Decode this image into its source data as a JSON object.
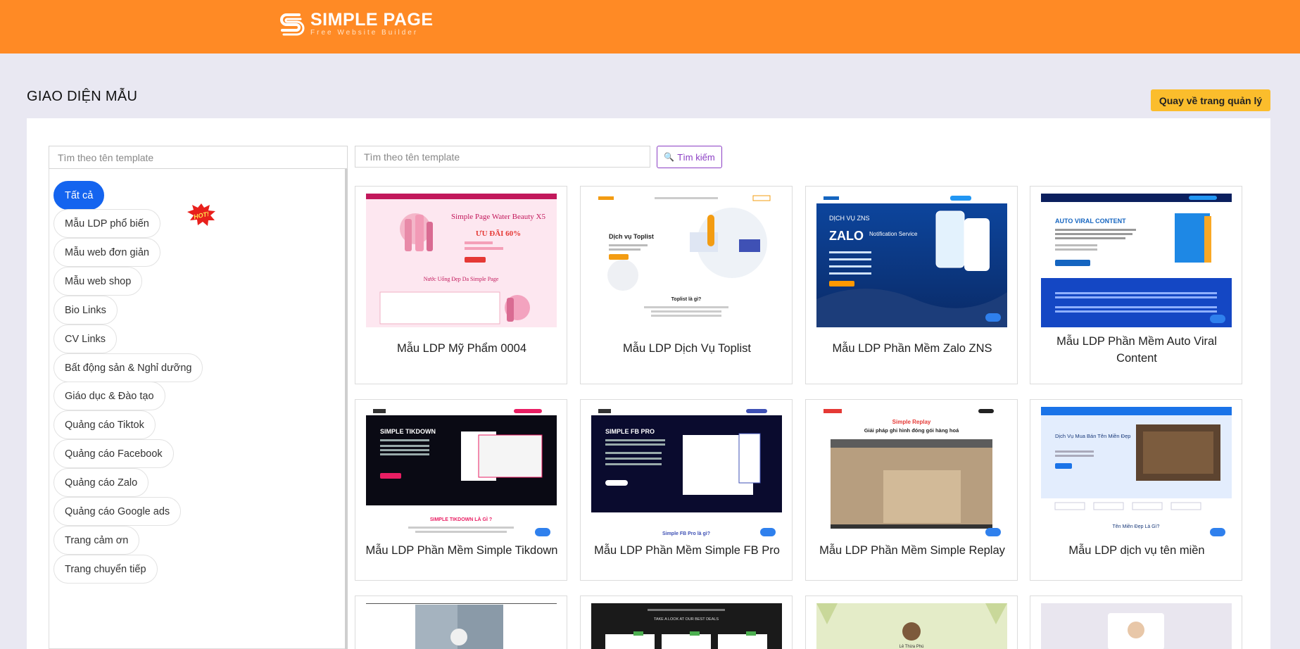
{
  "header": {
    "brand": "SIMPLE PAGE",
    "tagline": "Free Website Builder",
    "bg_color": "#ff8a25"
  },
  "page": {
    "title": "GIAO DIỆN MẪU",
    "back_button": "Quay về trang quản lý"
  },
  "sidebar": {
    "search_placeholder": "Tìm theo tên template",
    "hot_badge": "HOT!",
    "categories": [
      "Tất cả",
      "Mẫu LDP phổ biến",
      "Mẫu web đơn giản",
      "Mẫu web shop",
      "Bio Links",
      "CV Links",
      "Bất động sản & Nghỉ dưỡng",
      "Giáo dục & Đào tạo",
      "Quảng cáo Tiktok",
      "Quảng cáo Facebook",
      "Quảng cáo Zalo",
      "Quảng cáo Google ads",
      "Trang cảm ơn",
      "Trang chuyển tiếp"
    ]
  },
  "main": {
    "search_placeholder": "Tìm theo tên template",
    "search_button": "Tìm kiếm",
    "templates": [
      {
        "name": "Mẫu LDP Mỹ Phẩm 0004",
        "thumb_text": "Simple Page Water Beauty X5",
        "thumb_sub": "ƯU ĐÃI 60%",
        "thumb_line": "Nước Uống Đẹp Da Simple Page"
      },
      {
        "name": "Mẫu LDP Dịch Vụ Toplist",
        "thumb_text": "Dịch vụ Toplist",
        "thumb_sub": "Toplist là gì?",
        "thumb_line": ""
      },
      {
        "name": "Mẫu LDP Phần Mềm Zalo ZNS",
        "thumb_text": "DỊCH VỤ ZNS",
        "thumb_sub": "ZALO",
        "thumb_line": "Notification Service"
      },
      {
        "name": "Mẫu LDP Phần Mềm Auto Viral Content",
        "thumb_text": "AUTO VIRAL CONTENT",
        "thumb_sub": "",
        "thumb_line": ""
      },
      {
        "name": "Mẫu LDP Phần Mềm Simple Tikdown",
        "thumb_text": "SIMPLE TIKDOWN",
        "thumb_sub": "SIMPLE TIKDOWN LÀ GÌ ?",
        "thumb_line": ""
      },
      {
        "name": "Mẫu LDP Phần Mềm Simple FB Pro",
        "thumb_text": "SIMPLE FB PRO",
        "thumb_sub": "Simple FB Pro là gì?",
        "thumb_line": ""
      },
      {
        "name": "Mẫu LDP Phần Mềm Simple Replay",
        "thumb_text": "Simple Replay",
        "thumb_sub": "Giải pháp ghi hình đóng gói hàng hoá",
        "thumb_line": ""
      },
      {
        "name": "Mẫu LDP dịch vụ tên miền",
        "thumb_text": "Dịch Vụ Mua Bán Tên Miền Đẹp",
        "thumb_sub": "Tên Miền Đẹp Là Gì?",
        "thumb_line": ""
      },
      {
        "name": "",
        "thumb_text": "",
        "thumb_sub": "",
        "thumb_line": ""
      },
      {
        "name": "",
        "thumb_text": "TAKE A LOOK AT OUR BEST DEALS",
        "thumb_sub": "",
        "thumb_line": ""
      },
      {
        "name": "",
        "thumb_text": "Lê Thừa Phú",
        "thumb_sub": "",
        "thumb_line": ""
      },
      {
        "name": "",
        "thumb_text": "",
        "thumb_sub": "",
        "thumb_line": ""
      }
    ]
  }
}
